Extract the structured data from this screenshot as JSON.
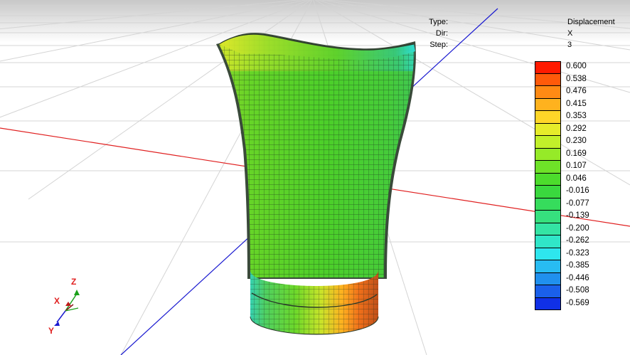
{
  "result_info": {
    "type_label": "Type:",
    "type_value": "Displacement",
    "dir_label": "Dir:",
    "dir_value": "X",
    "step_label": "Step:",
    "step_value": "3"
  },
  "legend": {
    "entries": [
      {
        "value": "0.600",
        "color": "#ff1a00"
      },
      {
        "value": "0.538",
        "color": "#ff5a0a"
      },
      {
        "value": "0.476",
        "color": "#ff8a14"
      },
      {
        "value": "0.415",
        "color": "#ffb21e"
      },
      {
        "value": "0.353",
        "color": "#ffd628"
      },
      {
        "value": "0.292",
        "color": "#e6ec2a"
      },
      {
        "value": "0.230",
        "color": "#c2f02a"
      },
      {
        "value": "0.169",
        "color": "#96ea28"
      },
      {
        "value": "0.107",
        "color": "#6ee228"
      },
      {
        "value": "0.046",
        "color": "#4cdc2c"
      },
      {
        "value": "-0.016",
        "color": "#3ad83e"
      },
      {
        "value": "-0.077",
        "color": "#36dc5c"
      },
      {
        "value": "-0.139",
        "color": "#36e07e"
      },
      {
        "value": "-0.200",
        "color": "#34e4a4"
      },
      {
        "value": "-0.262",
        "color": "#30e6c8"
      },
      {
        "value": "-0.323",
        "color": "#2ee6ee"
      },
      {
        "value": "-0.385",
        "color": "#28bcf2"
      },
      {
        "value": "-0.446",
        "color": "#2090ee"
      },
      {
        "value": "-0.508",
        "color": "#1a60ea"
      },
      {
        "value": "-0.569",
        "color": "#1030e6"
      }
    ]
  },
  "triad": {
    "x_label": "X",
    "y_label": "Y",
    "z_label": "Z"
  },
  "colors": {
    "x_axis": "#e02020",
    "y_axis": "#1a1ad0",
    "z_axis": "#1aa01a",
    "grid": "#d4d4d4",
    "mesh_line": "#1a2a1a"
  }
}
